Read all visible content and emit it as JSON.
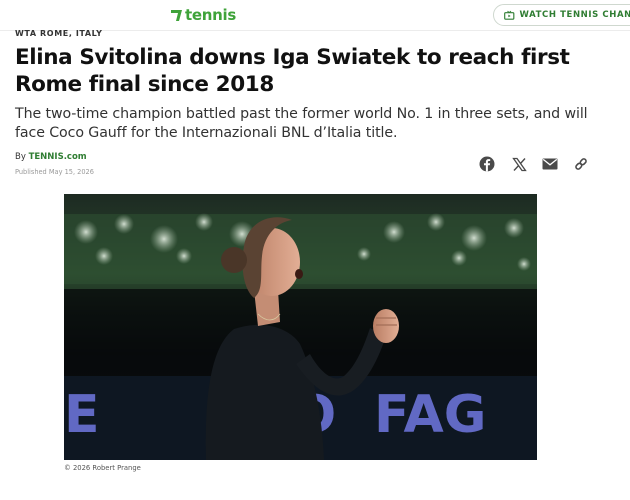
{
  "header": {
    "logo_text": "tennis",
    "watch_label": "WATCH TENNIS CHANNEL",
    "brand_color": "#3fa33a"
  },
  "article": {
    "kicker": "WTA ROME, ITALY",
    "headline": "Elina Svitolina downs Iga Swiatek to reach first Rome final since 2018",
    "dek": "The two-time champion battled past the former world No. 1 in three sets, and will face Coco Gauff for the Internazionali BNL d’Italia title.",
    "byline_prefix": "By ",
    "byline_author": "TENNIS.com",
    "published": "Published May 15, 2026"
  },
  "share_icons": [
    "facebook-icon",
    "x-icon",
    "email-icon",
    "link-icon"
  ],
  "hero": {
    "sponsor_text": "FAG",
    "credit": "© 2026 Robert Prange"
  }
}
